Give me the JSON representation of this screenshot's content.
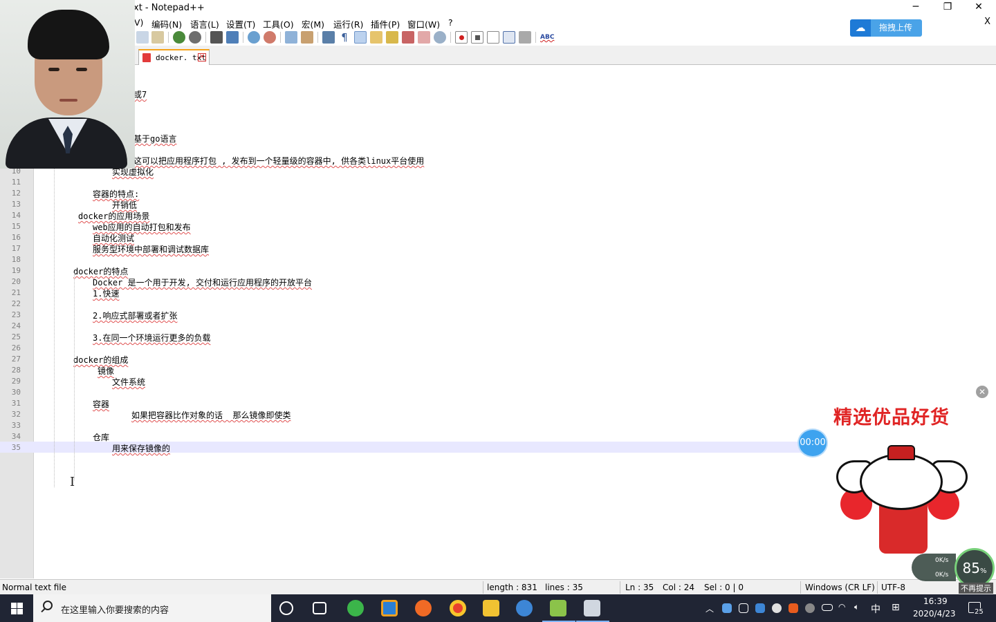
{
  "window": {
    "title": "xt - Notepad++",
    "minimize": "─",
    "maximize": "❐",
    "close": "✕"
  },
  "menu": {
    "items": [
      "V)",
      "编码(N)",
      "语言(L)",
      "设置(T)",
      "工具(O)",
      "宏(M)",
      "运行(R)",
      "插件(P)",
      "窗口(W)",
      "?"
    ],
    "close": "X"
  },
  "upload_button": {
    "label": "拖拽上传",
    "icon": "cloud-icon"
  },
  "tab": {
    "label": "docker. txt",
    "close": "✕"
  },
  "editor": {
    "lines": [
      {
        "n": "",
        "indent": 193,
        "text": "或7"
      },
      {
        "n": "",
        "indent": 193,
        "text": "基于go语言"
      },
      {
        "n": "",
        "indent": 193,
        "text": "这可以把应用程序打包 , 发布到一个轻量级的容器中, 供各类linux平台使用"
      },
      {
        "n": "10",
        "indent": 162,
        "text": "实现虚拟化"
      },
      {
        "n": "11",
        "indent": 0,
        "text": ""
      },
      {
        "n": "12",
        "indent": 134,
        "text": "容器的特点:"
      },
      {
        "n": "13",
        "indent": 162,
        "text": "开销低"
      },
      {
        "n": "14",
        "indent": 113,
        "text": "docker的应用场景"
      },
      {
        "n": "15",
        "indent": 134,
        "text": "web应用的自动打包和发布"
      },
      {
        "n": "16",
        "indent": 134,
        "text": "自动化测试"
      },
      {
        "n": "17",
        "indent": 134,
        "text": "服务型环境中部署和调试数据库"
      },
      {
        "n": "18",
        "indent": 0,
        "text": ""
      },
      {
        "n": "19",
        "indent": 106,
        "text": "docker的特点"
      },
      {
        "n": "20",
        "indent": 134,
        "text": "Docker 是一个用于开发, 交付和运行应用程序的开放平台"
      },
      {
        "n": "21",
        "indent": 134,
        "text": "1.快速"
      },
      {
        "n": "22",
        "indent": 0,
        "text": ""
      },
      {
        "n": "23",
        "indent": 134,
        "text": "2.响应式部署或者扩张"
      },
      {
        "n": "24",
        "indent": 0,
        "text": ""
      },
      {
        "n": "25",
        "indent": 134,
        "text": "3.在同一个环境运行更多的负载"
      },
      {
        "n": "26",
        "indent": 0,
        "text": ""
      },
      {
        "n": "27",
        "indent": 106,
        "text": "docker的组成"
      },
      {
        "n": "28",
        "indent": 141,
        "text": "镜像"
      },
      {
        "n": "29",
        "indent": 162,
        "text": "文件系统"
      },
      {
        "n": "30",
        "indent": 0,
        "text": ""
      },
      {
        "n": "31",
        "indent": 134,
        "text": "容器"
      },
      {
        "n": "32",
        "indent": 190,
        "text": "如果把容器比作对象的话  那么镜像即使类"
      },
      {
        "n": "33",
        "indent": 0,
        "text": ""
      },
      {
        "n": "34",
        "indent": 134,
        "text": "仓库"
      },
      {
        "n": "35",
        "indent": 162,
        "text": "用来保存镜像的"
      }
    ]
  },
  "status": {
    "file_type": "Normal text file",
    "length": "length : 831",
    "lines": "lines : 35",
    "ln": "Ln : 35",
    "col": "Col : 24",
    "sel": "Sel : 0 | 0",
    "eol": "Windows (CR LF)",
    "encoding": "UTF-8"
  },
  "taskbar": {
    "search_placeholder": "在这里输入你要搜索的内容",
    "time": "16:39",
    "date": "2020/4/23",
    "ime": "中",
    "notifications": "25"
  },
  "overlays": {
    "ad_title": "精选优品好货",
    "timer": "00:00",
    "gauge": "85",
    "gauge_unit": "%",
    "speed_up": "0K/s",
    "speed_down": "0K/s",
    "hint": "不再提示"
  },
  "colors": {
    "tab_accent": "#f5a31a",
    "current_line": "#e8e8ff",
    "spell_underline": "#e05050",
    "taskbar": "#202534",
    "upload": "#4aa3e8"
  }
}
